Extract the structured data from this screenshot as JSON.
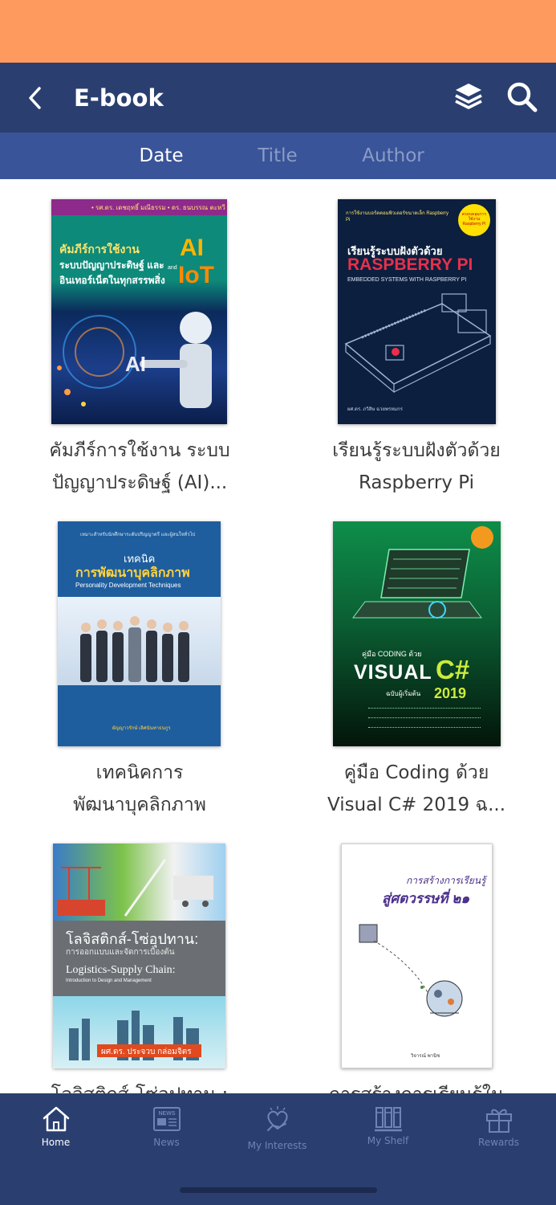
{
  "header": {
    "title": "E-book",
    "back_icon": "chevron-left-icon",
    "layers_icon": "layers-icon",
    "search_icon": "search-icon"
  },
  "sort_tabs": [
    {
      "label": "Date",
      "active": true
    },
    {
      "label": "Title",
      "active": false
    },
    {
      "label": "Author",
      "active": false
    }
  ],
  "books": [
    {
      "title_line1": "คัมภีร์การใช้งาน ระบบ",
      "title_line2": "ปัญญาประดิษฐ์ (AI)...",
      "cover": {
        "authors": "• รศ.ดร. เดชฤทธิ์ มณีธรรม • ดร. ธนบรรณ ตะหวี",
        "heading1": "คัมภีร์การใช้งาน",
        "heading2": "ระบบปัญญาประดิษฐ์ และ",
        "heading3": "อินเทอร์เน็ตในทุกสรรพสิ่ง",
        "big1": "AI",
        "big2": "IoT",
        "and": "and",
        "mid": "AI",
        "accent": "#1DAA8E"
      }
    },
    {
      "title_line1": "เรียนรู้ระบบฝังตัวด้วย",
      "title_line2": "Raspberry Pi",
      "cover": {
        "top_text": "การใช้งานบอร์ดคอมพิวเตอร์ขนาดเล็ก Raspberry Pi",
        "badge": "ครอบคลุมการใช้งาน Raspberry Pi",
        "heading": "เรียนรู้ระบบฝังตัวด้วย",
        "big": "RASPBERRY PI",
        "sub": "EMBEDDED SYSTEMS WITH RASPBERRY PI",
        "author": "ผศ.ดร. ภวิสิษ ฉวยพรหมกร",
        "accent": "#E8304A"
      }
    },
    {
      "title_line1": "เทคนิคการ",
      "title_line2": "พัฒนาบุคลิกภาพ",
      "cover": {
        "top_text": "เหมาะสำหรับนักศึกษาระดับปริญญาตรี และผู้สนใจทั่วไป",
        "heading1": "เทคนิค",
        "heading2": "การพัฒนาบุคลิกภาพ",
        "sub": "Personality Development Techniques",
        "author": "ผัญญาวรักษ์ เลิศนันทาธนกูร",
        "accent": "#1E5E9E"
      }
    },
    {
      "title_line1": "คู่มือ Coding ด้วย",
      "title_line2": "Visual C# 2019 ฉ...",
      "cover": {
        "small": "คู่มือ CODING ด้วย",
        "big1": "VISUAL",
        "big2": "C#",
        "year": "2019",
        "edition": "ฉบับผู้เริ่มต้น",
        "accent": "#0E6E3A"
      }
    },
    {
      "title_line1": "โลจิสติกส์-โซ่อุปทาน :",
      "title_line2": "",
      "cover": {
        "heading1": "โลจิสติกส์-โซ่อุปทาน:",
        "heading2": "การออกแบบและจัดการเบื้องต้น",
        "en1": "Logistics-Supply Chain:",
        "en2": "Introduction to Design and Management",
        "author": "ผศ.ดร. ประจวบ กล่อมจิตร",
        "accent": "#6B6F73"
      }
    },
    {
      "title_line1": "การสร้างการเรียนรู้ใน",
      "title_line2": "",
      "cover": {
        "heading1": "การสร้างการเรียนรู้",
        "heading2": "สู่ศตวรรษที่ ๒๑",
        "author": "วิจารณ์ พานิช",
        "accent": "#4A2F8A"
      }
    }
  ],
  "bottom_nav": [
    {
      "label": "Home",
      "icon": "home-icon",
      "active": true
    },
    {
      "label": "News",
      "icon": "news-icon",
      "active": false
    },
    {
      "label": "My Interests",
      "icon": "heart-hand-icon",
      "active": false
    },
    {
      "label": "My Shelf",
      "icon": "bookshelf-icon",
      "active": false
    },
    {
      "label": "Rewards",
      "icon": "gift-icon",
      "active": false
    }
  ]
}
